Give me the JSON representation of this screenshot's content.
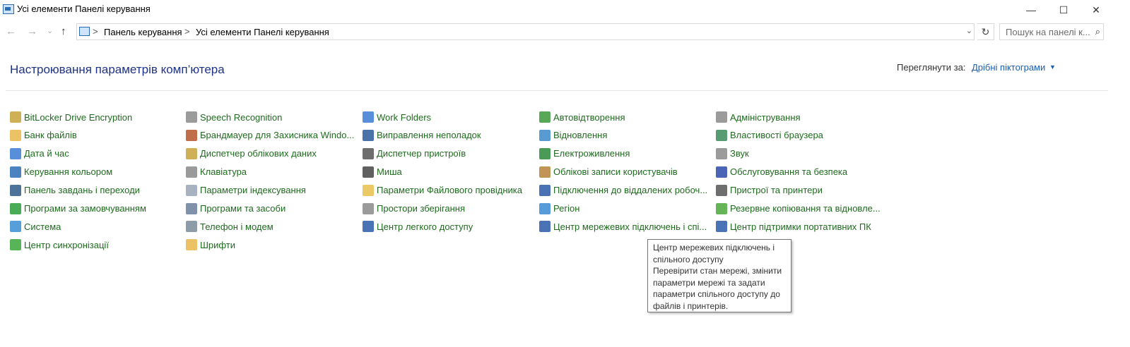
{
  "window": {
    "title": "Усі елементи Панелі керування",
    "minimize": "—",
    "maximize": "☐",
    "close": "✕"
  },
  "addressbar": {
    "back": "←",
    "forward": "→",
    "recent": "⌄",
    "up": "↑",
    "breadcrumb": [
      "Панель керування",
      "Усі елементи Панелі керування"
    ],
    "separator": ">",
    "dropdown": "⌄",
    "refresh": "↻",
    "search_placeholder": "Пошук на панелі к...",
    "search_icon": "⌕"
  },
  "header": {
    "title": "Настроювання параметрів комп’ютера",
    "view_by_label": "Переглянути за:",
    "view_by_value": "Дрібні піктограми",
    "view_by_arrow": "▼"
  },
  "columns": [
    [
      {
        "label": "BitLocker Drive Encryption",
        "icon": "bitlocker-icon",
        "color": "#c8a23a"
      },
      {
        "label": "Банк файлів",
        "icon": "file-history-icon",
        "color": "#e8b84a"
      },
      {
        "label": "Дата й час",
        "icon": "date-time-icon",
        "color": "#3a7bd5"
      },
      {
        "label": "Керування кольором",
        "icon": "color-management-icon",
        "color": "#2a6db5"
      },
      {
        "label": "Панель завдань і переходи",
        "icon": "taskbar-icon",
        "color": "#2e5a8a"
      },
      {
        "label": "Програми за замовчуванням",
        "icon": "default-programs-icon",
        "color": "#2a9d3a"
      },
      {
        "label": "Система",
        "icon": "system-icon",
        "color": "#3a8ed5"
      },
      {
        "label": "Центр синхронізації",
        "icon": "sync-center-icon",
        "color": "#3aa83a"
      }
    ],
    [
      {
        "label": "Speech Recognition",
        "icon": "microphone-icon",
        "color": "#8a8a8a"
      },
      {
        "label": "Брандмауер для Захисника Windo...",
        "icon": "firewall-icon",
        "color": "#b5532a"
      },
      {
        "label": "Диспетчер облікових даних",
        "icon": "credential-manager-icon",
        "color": "#c8a23a"
      },
      {
        "label": "Клавіатура",
        "icon": "keyboard-icon",
        "color": "#888888"
      },
      {
        "label": "Параметри індексування",
        "icon": "indexing-icon",
        "color": "#9aa5b5"
      },
      {
        "label": "Програми та засоби",
        "icon": "programs-features-icon",
        "color": "#6a7f9a"
      },
      {
        "label": "Телефон і модем",
        "icon": "phone-modem-icon",
        "color": "#7a8a9a"
      },
      {
        "label": "Шрифти",
        "icon": "fonts-icon",
        "color": "#e8b84a"
      }
    ],
    [
      {
        "label": "Work Folders",
        "icon": "work-folders-icon",
        "color": "#3a7bd5"
      },
      {
        "label": "Виправлення неполадок",
        "icon": "troubleshooting-icon",
        "color": "#2a5a9a"
      },
      {
        "label": "Диспетчер пристроїв",
        "icon": "device-manager-icon",
        "color": "#555555"
      },
      {
        "label": "Миша",
        "icon": "mouse-icon",
        "color": "#444444"
      },
      {
        "label": "Параметри Файлового провідника",
        "icon": "file-explorer-options-icon",
        "color": "#e8c04a"
      },
      {
        "label": "Простори зберігання",
        "icon": "storage-spaces-icon",
        "color": "#8a8a8a"
      },
      {
        "label": "Центр легкого доступу",
        "icon": "ease-of-access-icon",
        "color": "#2a5aa8"
      }
    ],
    [
      {
        "label": "Автовідтворення",
        "icon": "autoplay-icon",
        "color": "#3a9a3a"
      },
      {
        "label": "Відновлення",
        "icon": "recovery-icon",
        "color": "#3a8ac8"
      },
      {
        "label": "Електроживлення",
        "icon": "power-options-icon",
        "color": "#2a8a3a"
      },
      {
        "label": "Облікові записи користувачів",
        "icon": "user-accounts-icon",
        "color": "#b5823a"
      },
      {
        "label": "Підключення до віддалених робоч...",
        "icon": "remote-desktop-icon",
        "color": "#2a5aa8"
      },
      {
        "label": "Регіон",
        "icon": "region-icon",
        "color": "#3a8ad5"
      },
      {
        "label": "Центр мережевих підключень і спі...",
        "icon": "network-center-icon",
        "color": "#2a5aa8"
      }
    ],
    [
      {
        "label": "Адміністрування",
        "icon": "administrative-tools-icon",
        "color": "#8a8a8a"
      },
      {
        "label": "Властивості браузера",
        "icon": "internet-options-icon",
        "color": "#3a8a5a"
      },
      {
        "label": "Звук",
        "icon": "sound-icon",
        "color": "#8a8a8a"
      },
      {
        "label": "Обслуговування та безпека",
        "icon": "security-maintenance-icon",
        "color": "#2a4aa8"
      },
      {
        "label": "Пристрої та принтери",
        "icon": "devices-printers-icon",
        "color": "#555555"
      },
      {
        "label": "Резервне копіювання та відновле...",
        "icon": "backup-restore-icon",
        "color": "#4aa83a"
      },
      {
        "label": "Центр підтримки портативних ПК",
        "icon": "mobility-center-icon",
        "color": "#2a5aa8"
      }
    ]
  ],
  "tooltip": {
    "title": "Центр мережевих підключень і спільного доступу",
    "body": "Перевірити стан мережі, змінити параметри мережі та задати параметри спільного доступу до файлів і принтерів."
  }
}
